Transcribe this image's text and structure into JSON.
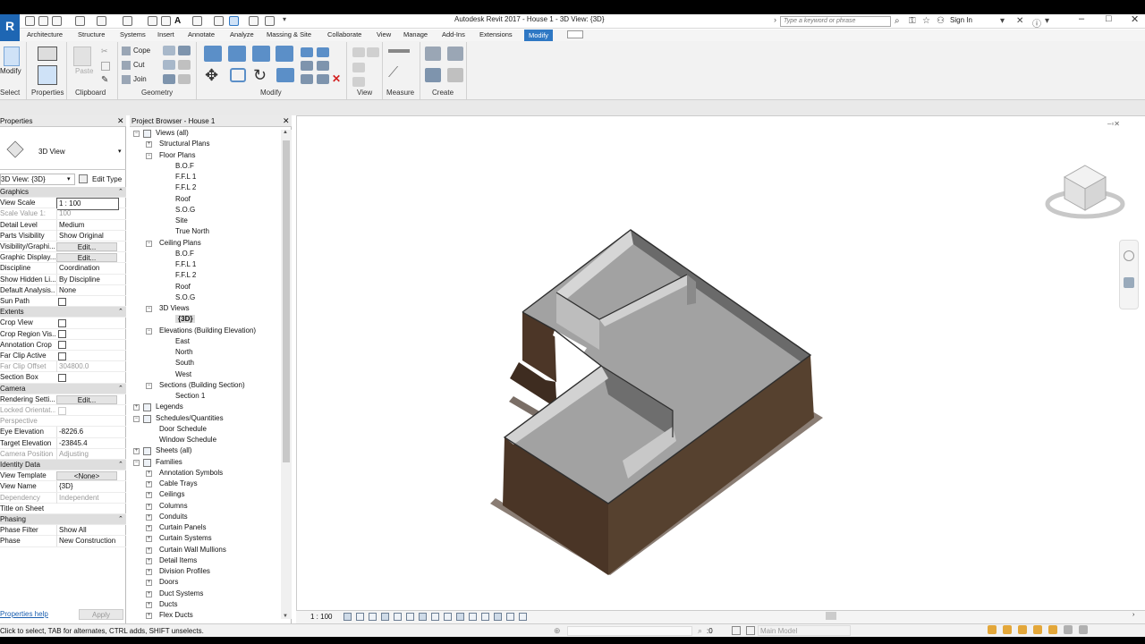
{
  "window": {
    "title": "Autodesk Revit 2017 -     House 1 - 3D View: {3D}",
    "search_placeholder": "Type a keyword or phrase",
    "sign_in": "Sign In"
  },
  "app_button": "R",
  "tabs": [
    "Architecture",
    "Structure",
    "Systems",
    "Insert",
    "Annotate",
    "Analyze",
    "Massing & Site",
    "Collaborate",
    "View",
    "Manage",
    "Add-Ins",
    "Extensions"
  ],
  "active_tab": "Modify",
  "ribbon": {
    "panels": [
      "Select",
      "Properties",
      "Clipboard",
      "Geometry",
      "Modify",
      "View",
      "Measure",
      "Create"
    ],
    "modify_label": "Modify",
    "paste_label": "Paste",
    "cope": "Cope",
    "cut": "Cut",
    "join": "Join"
  },
  "properties": {
    "header": "Properties",
    "type_name": "3D View",
    "selector": "3D View: {3D}",
    "edit_type": "Edit Type",
    "help": "Properties help",
    "apply": "Apply",
    "rows": [
      {
        "kind": "group",
        "name": "Graphics"
      },
      {
        "kind": "value",
        "name": "View Scale",
        "value": "1 : 100"
      },
      {
        "kind": "value",
        "name": "Scale Value    1:",
        "value": "100",
        "dim": true
      },
      {
        "kind": "value",
        "name": "Detail Level",
        "value": "Medium"
      },
      {
        "kind": "value",
        "name": "Parts Visibility",
        "value": "Show Original"
      },
      {
        "kind": "button",
        "name": "Visibility/Graphi...",
        "value": "Edit..."
      },
      {
        "kind": "button",
        "name": "Graphic Display...",
        "value": "Edit..."
      },
      {
        "kind": "value",
        "name": "Discipline",
        "value": "Coordination"
      },
      {
        "kind": "value",
        "name": "Show Hidden Li...",
        "value": "By Discipline"
      },
      {
        "kind": "value",
        "name": "Default Analysis...",
        "value": "None"
      },
      {
        "kind": "check",
        "name": "Sun Path",
        "checked": false
      },
      {
        "kind": "group",
        "name": "Extents"
      },
      {
        "kind": "check",
        "name": "Crop View",
        "checked": false
      },
      {
        "kind": "check",
        "name": "Crop Region Vis...",
        "checked": false
      },
      {
        "kind": "check",
        "name": "Annotation Crop",
        "checked": false
      },
      {
        "kind": "check",
        "name": "Far Clip Active",
        "checked": false
      },
      {
        "kind": "value",
        "name": "Far Clip Offset",
        "value": "304800.0",
        "dim": true
      },
      {
        "kind": "check",
        "name": "Section Box",
        "checked": false
      },
      {
        "kind": "group",
        "name": "Camera"
      },
      {
        "kind": "button",
        "name": "Rendering Setti...",
        "value": "Edit..."
      },
      {
        "kind": "check",
        "name": "Locked Orientat...",
        "checked": false,
        "dim": true
      },
      {
        "kind": "value",
        "name": "Perspective",
        "value": "",
        "dim": true
      },
      {
        "kind": "value",
        "name": "Eye Elevation",
        "value": "-8226.6"
      },
      {
        "kind": "value",
        "name": "Target Elevation",
        "value": "-23845.4"
      },
      {
        "kind": "value",
        "name": "Camera Position",
        "value": "Adjusting",
        "dim": true
      },
      {
        "kind": "group",
        "name": "Identity Data"
      },
      {
        "kind": "button",
        "name": "View Template",
        "value": "<None>"
      },
      {
        "kind": "value",
        "name": "View Name",
        "value": "{3D}"
      },
      {
        "kind": "value",
        "name": "Dependency",
        "value": "Independent",
        "dim": true
      },
      {
        "kind": "value",
        "name": "Title on Sheet",
        "value": ""
      },
      {
        "kind": "group",
        "name": "Phasing"
      },
      {
        "kind": "value",
        "name": "Phase Filter",
        "value": "Show All"
      },
      {
        "kind": "value",
        "name": "Phase",
        "value": "New Construction"
      }
    ]
  },
  "browser": {
    "header": "Project Browser - House 1",
    "items": [
      {
        "label": "Views (all)",
        "level": 0,
        "toggle": "-"
      },
      {
        "label": "Structural Plans",
        "level": 1,
        "toggle": "+"
      },
      {
        "label": "Floor Plans",
        "level": 1,
        "toggle": "-"
      },
      {
        "label": "B.O.F",
        "level": 2
      },
      {
        "label": "F.F.L 1",
        "level": 2
      },
      {
        "label": "F.F.L 2",
        "level": 2
      },
      {
        "label": "Roof",
        "level": 2
      },
      {
        "label": "S.O.G",
        "level": 2
      },
      {
        "label": "Site",
        "level": 2
      },
      {
        "label": "True North",
        "level": 2
      },
      {
        "label": "Ceiling Plans",
        "level": 1,
        "toggle": "-"
      },
      {
        "label": "B.O.F",
        "level": 2
      },
      {
        "label": "F.F.L 1",
        "level": 2
      },
      {
        "label": "F.F.L 2",
        "level": 2
      },
      {
        "label": "Roof",
        "level": 2
      },
      {
        "label": "S.O.G",
        "level": 2
      },
      {
        "label": "3D Views",
        "level": 1,
        "toggle": "-"
      },
      {
        "label": "{3D}",
        "level": 2,
        "selected": true
      },
      {
        "label": "Elevations (Building Elevation)",
        "level": 1,
        "toggle": "-"
      },
      {
        "label": "East",
        "level": 2
      },
      {
        "label": "North",
        "level": 2
      },
      {
        "label": "South",
        "level": 2
      },
      {
        "label": "West",
        "level": 2
      },
      {
        "label": "Sections (Building Section)",
        "level": 1,
        "toggle": "-"
      },
      {
        "label": "Section 1",
        "level": 2
      },
      {
        "label": "Legends",
        "level": 0,
        "toggle": "+"
      },
      {
        "label": "Schedules/Quantities",
        "level": 0,
        "toggle": "-"
      },
      {
        "label": "Door Schedule",
        "level": 1
      },
      {
        "label": "Window Schedule",
        "level": 1
      },
      {
        "label": "Sheets (all)",
        "level": 0,
        "toggle": "+"
      },
      {
        "label": "Families",
        "level": 0,
        "toggle": "-"
      },
      {
        "label": "Annotation Symbols",
        "level": 1,
        "toggle": "+"
      },
      {
        "label": "Cable Trays",
        "level": 1,
        "toggle": "+"
      },
      {
        "label": "Ceilings",
        "level": 1,
        "toggle": "+"
      },
      {
        "label": "Columns",
        "level": 1,
        "toggle": "+"
      },
      {
        "label": "Conduits",
        "level": 1,
        "toggle": "+"
      },
      {
        "label": "Curtain Panels",
        "level": 1,
        "toggle": "+"
      },
      {
        "label": "Curtain Systems",
        "level": 1,
        "toggle": "+"
      },
      {
        "label": "Curtain Wall Mullions",
        "level": 1,
        "toggle": "+"
      },
      {
        "label": "Detail Items",
        "level": 1,
        "toggle": "+"
      },
      {
        "label": "Division Profiles",
        "level": 1,
        "toggle": "+"
      },
      {
        "label": "Doors",
        "level": 1,
        "toggle": "+"
      },
      {
        "label": "Duct Systems",
        "level": 1,
        "toggle": "+"
      },
      {
        "label": "Ducts",
        "level": 1,
        "toggle": "+"
      },
      {
        "label": "Flex Ducts",
        "level": 1,
        "toggle": "+"
      }
    ]
  },
  "viewbar": {
    "scale": "1 : 100"
  },
  "status": {
    "message": "Click to select, TAB for alternates, CTRL adds, SHIFT unselects.",
    "value": ":0",
    "model": "Main Model"
  },
  "colors": {
    "accent": "#2f78c4",
    "wall_dark": "#4a3526",
    "wall_light": "#b9b9b9",
    "floor": "#9e9e9e"
  }
}
